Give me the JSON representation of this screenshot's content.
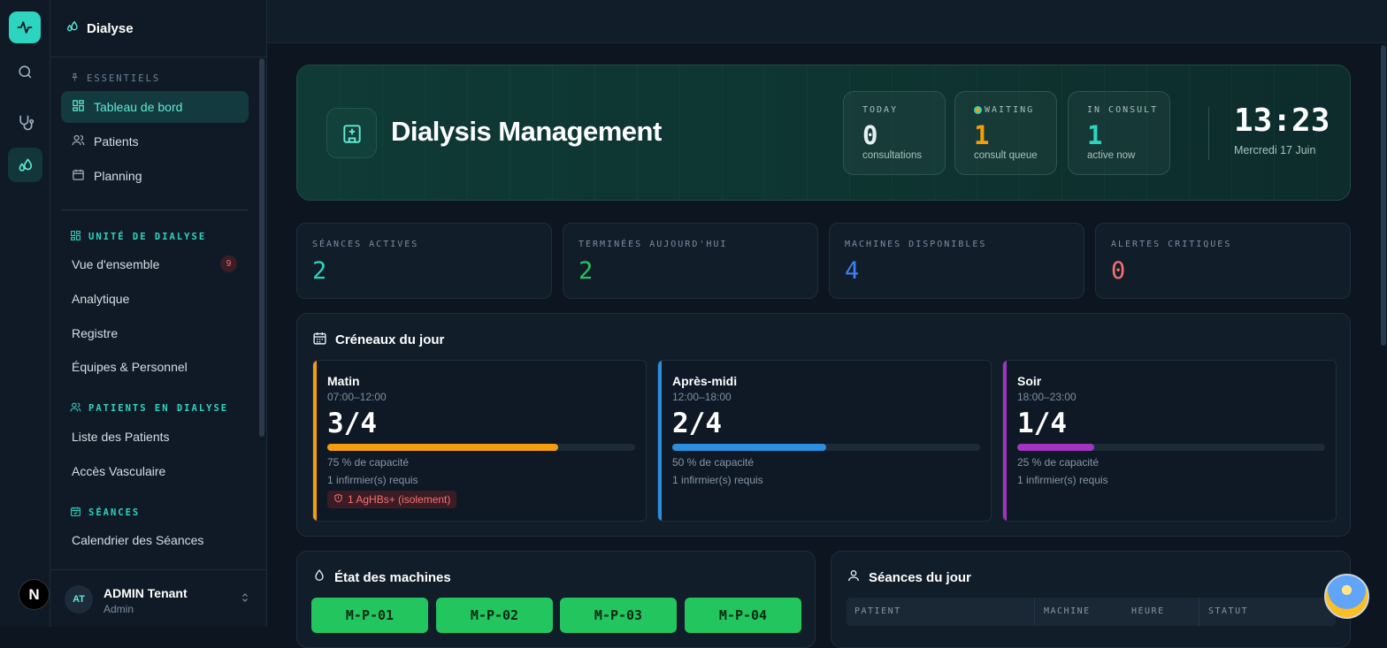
{
  "app": {
    "title": "Dialyse"
  },
  "sidebar": {
    "sections": {
      "essentiels": "ESSENTIELS",
      "unite": "UNITÉ DE DIALYSE",
      "patients": "PATIENTS EN DIALYSE",
      "seances": "SÉANCES"
    },
    "essentiels_items": [
      {
        "label": "Tableau de bord",
        "icon": "dashboard-icon"
      },
      {
        "label": "Patients",
        "icon": "users-icon"
      },
      {
        "label": "Planning",
        "icon": "calendar-icon"
      }
    ],
    "unite_items": [
      {
        "label": "Vue d'ensemble",
        "badge": "9"
      },
      {
        "label": "Analytique"
      },
      {
        "label": "Registre"
      },
      {
        "label": "Équipes & Personnel"
      }
    ],
    "patients_items": [
      {
        "label": "Liste des Patients"
      },
      {
        "label": "Accès Vasculaire"
      }
    ],
    "seances_items": [
      {
        "label": "Calendrier des Séances"
      }
    ],
    "user": {
      "initials": "AT",
      "name": "ADMIN Tenant",
      "role": "Admin"
    }
  },
  "rail": {
    "badge": "N"
  },
  "hero": {
    "title": "Dialysis Management",
    "stats": [
      {
        "label": "TODAY",
        "value": "0",
        "sub": "consultations",
        "color": "#e6edf3"
      },
      {
        "label": "WAITING",
        "value": "1",
        "sub": "consult queue",
        "color": "#f59e0b"
      },
      {
        "label": "IN CONSULT",
        "value": "1",
        "sub": "active now",
        "color": "#2dd4bf"
      }
    ],
    "clock": "13:23",
    "date": "Mercredi 17 Juin"
  },
  "kpis": [
    {
      "label": "SÉANCES ACTIVES",
      "value": "2",
      "color": "#2dd4bf"
    },
    {
      "label": "TERMINÉES AUJOURD'HUI",
      "value": "2",
      "color": "#22c55e"
    },
    {
      "label": "MACHINES DISPONIBLES",
      "value": "4",
      "color": "#3b82f6"
    },
    {
      "label": "ALERTES CRITIQUES",
      "value": "0",
      "color": "#f87171"
    }
  ],
  "creneaux": {
    "title": "Créneaux du jour",
    "slots": [
      {
        "name": "Matin",
        "time": "07:00–12:00",
        "count": "3/4",
        "capacity": 0.75,
        "cap_label": "75 % de capacité",
        "nurses": "1 infirmier(s) requis",
        "alert": "1 AgHBs+ (isolement)",
        "color": "#f59e0b"
      },
      {
        "name": "Après-midi",
        "time": "12:00–18:00",
        "count": "2/4",
        "capacity": 0.5,
        "cap_label": "50 % de capacité",
        "nurses": "1 infirmier(s) requis",
        "color": "#2b8ee0"
      },
      {
        "name": "Soir",
        "time": "18:00–23:00",
        "count": "1/4",
        "capacity": 0.25,
        "cap_label": "25 % de capacité",
        "nurses": "1 infirmier(s) requis",
        "color": "#a233c0"
      }
    ]
  },
  "machines": {
    "title": "État des machines",
    "items": [
      "M-P-01",
      "M-P-02",
      "M-P-03",
      "M-P-04"
    ]
  },
  "seances": {
    "title": "Séances du jour",
    "columns": [
      "PATIENT",
      "MACHINE",
      "HEURE",
      "STATUT"
    ]
  }
}
